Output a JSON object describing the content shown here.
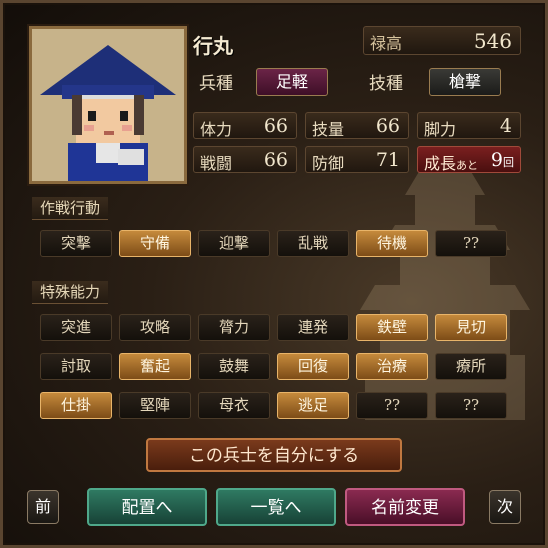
{
  "unit": {
    "name": "行丸",
    "stipend_label": "禄高",
    "stipend_value": "546",
    "troop_type_label": "兵種",
    "troop_type": "足軽",
    "skill_type_label": "技種",
    "skill_type": "槍撃"
  },
  "stats": [
    {
      "label": "体力",
      "value": "66"
    },
    {
      "label": "技量",
      "value": "66"
    },
    {
      "label": "脚力",
      "value": "4"
    },
    {
      "label": "戦闘",
      "value": "66"
    },
    {
      "label": "防御",
      "value": "71"
    }
  ],
  "growth": {
    "label": "成長",
    "small": "あと",
    "value": "9",
    "unit": "回"
  },
  "tactics": {
    "title": "作戦行動",
    "items": [
      {
        "label": "突撃",
        "active": false
      },
      {
        "label": "守備",
        "active": true
      },
      {
        "label": "迎撃",
        "active": false
      },
      {
        "label": "乱戦",
        "active": false
      },
      {
        "label": "待機",
        "active": true
      },
      {
        "label": "??",
        "active": false
      }
    ]
  },
  "abilities": {
    "title": "特殊能力",
    "items": [
      {
        "label": "突進",
        "active": false
      },
      {
        "label": "攻略",
        "active": false
      },
      {
        "label": "膂力",
        "active": false
      },
      {
        "label": "連発",
        "active": false
      },
      {
        "label": "鉄壁",
        "active": true
      },
      {
        "label": "見切",
        "active": true
      },
      {
        "label": "討取",
        "active": false
      },
      {
        "label": "奮起",
        "active": true
      },
      {
        "label": "鼓舞",
        "active": false
      },
      {
        "label": "回復",
        "active": true
      },
      {
        "label": "治療",
        "active": true
      },
      {
        "label": "療所",
        "active": false
      },
      {
        "label": "仕掛",
        "active": true
      },
      {
        "label": "堅陣",
        "active": false
      },
      {
        "label": "母衣",
        "active": false
      },
      {
        "label": "逃足",
        "active": true
      },
      {
        "label": "??",
        "active": false
      },
      {
        "label": "??",
        "active": false
      }
    ]
  },
  "actions": {
    "adopt": "この兵士を自分にする",
    "prev": "前",
    "deploy": "配置へ",
    "list": "一覧へ",
    "rename": "名前変更",
    "next": "次"
  },
  "colors": {
    "active_button": "#c58a3c",
    "troop_badge": "#5a1b3a",
    "deploy_button": "#1f5a4a",
    "rename_button": "#6a1a3a",
    "growth_badge": "#6a1818"
  }
}
